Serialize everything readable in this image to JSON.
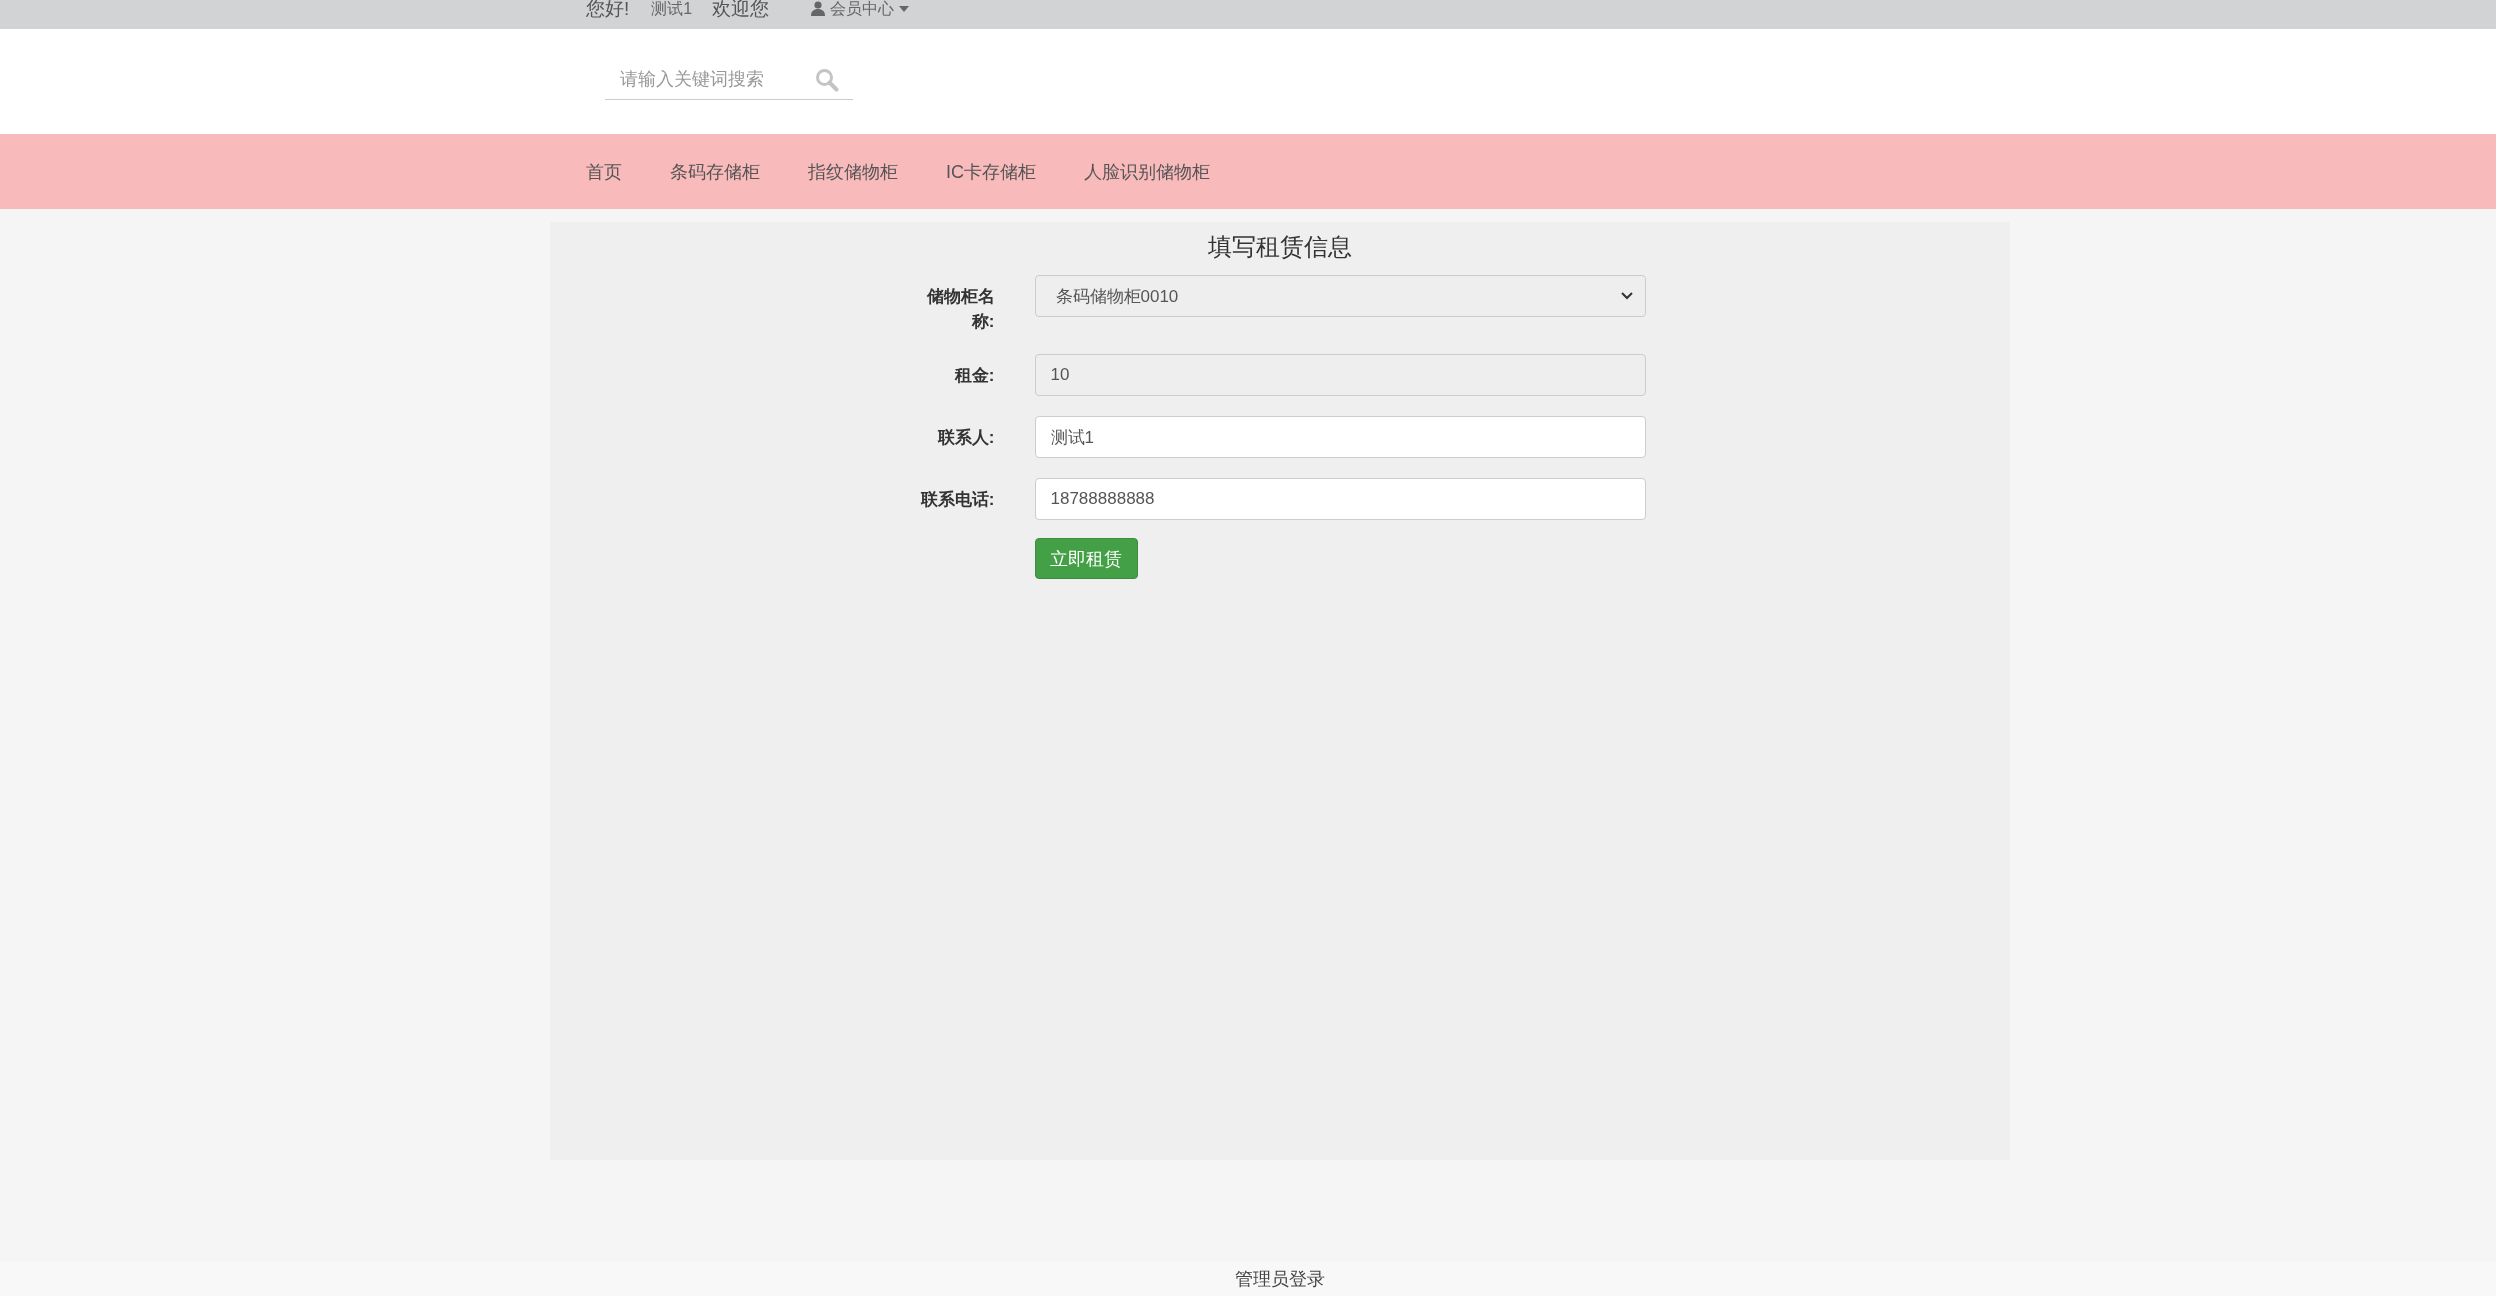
{
  "top_bar": {
    "greeting": "您好!",
    "username": "测试1",
    "welcome": "欢迎您",
    "member_menu": "会员中心"
  },
  "search": {
    "placeholder": "请输入关键词搜索"
  },
  "nav": {
    "items": [
      {
        "label": "首页"
      },
      {
        "label": "条码存储柜"
      },
      {
        "label": "指纹储物柜"
      },
      {
        "label": "IC卡存储柜"
      },
      {
        "label": "人脸识别储物柜"
      }
    ]
  },
  "form": {
    "title": "填写租赁信息",
    "fields": [
      {
        "label": "储物柜名称:",
        "kind": "select",
        "value": "条码储物柜0010"
      },
      {
        "label": "租金:",
        "kind": "readonly",
        "value": "10"
      },
      {
        "label": "联系人:",
        "kind": "text",
        "value": "测试1"
      },
      {
        "label": "联系电话:",
        "kind": "text",
        "value": "18788888888"
      }
    ],
    "submit": "立即租赁"
  },
  "footer": {
    "link": "管理员登录"
  }
}
